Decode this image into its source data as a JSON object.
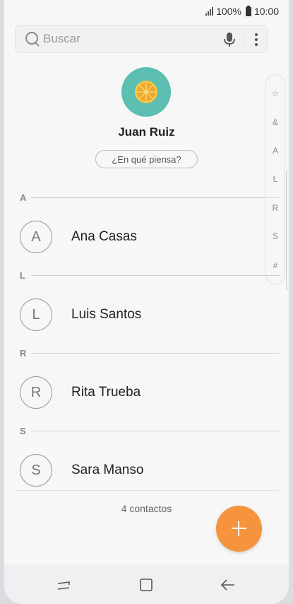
{
  "status_bar": {
    "battery": "100%",
    "time": "10:00"
  },
  "search": {
    "placeholder": "Buscar"
  },
  "profile": {
    "name": "Juan Ruiz",
    "status_prompt": "¿En qué piensa?"
  },
  "index_letters": [
    "☆",
    "&",
    "A",
    "L",
    "R",
    "S",
    "#"
  ],
  "sections": [
    {
      "letter": "A",
      "contacts": [
        {
          "initial": "A",
          "name": "Ana Casas"
        }
      ]
    },
    {
      "letter": "L",
      "contacts": [
        {
          "initial": "L",
          "name": "Luis Santos"
        }
      ]
    },
    {
      "letter": "R",
      "contacts": [
        {
          "initial": "R",
          "name": "Rita Trueba"
        }
      ]
    },
    {
      "letter": "S",
      "contacts": [
        {
          "initial": "S",
          "name": "Sara Manso"
        }
      ]
    }
  ],
  "footer": {
    "count_text": "4 contactos"
  },
  "colors": {
    "accent": "#f5943c",
    "profile_avatar_bg": "#5cbfb1",
    "orange_slice": "#f0a72a"
  },
  "icons": {
    "search": "search-icon",
    "mic": "mic-icon",
    "more": "more-vert-icon",
    "fab": "plus-icon",
    "nav_recent": "recent-apps-icon",
    "nav_home": "home-icon",
    "nav_back": "back-icon"
  }
}
